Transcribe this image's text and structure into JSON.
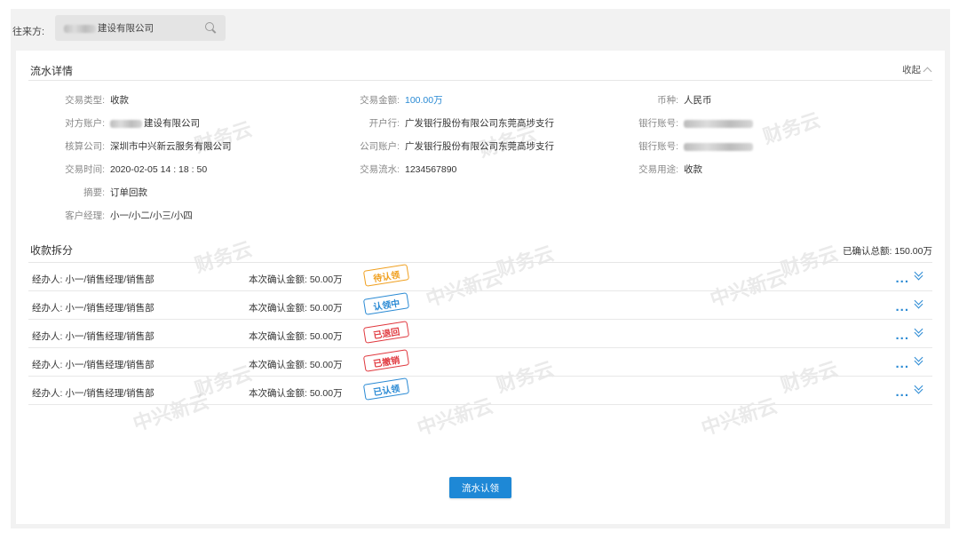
{
  "filter": {
    "label": "往来方:",
    "value_suffix": "建设有限公司"
  },
  "detail": {
    "title": "流水详情",
    "collapse_label": "收起",
    "fields": [
      {
        "label": "交易类型:",
        "value": "收款"
      },
      {
        "label": "交易金额:",
        "value": "100.00万",
        "highlight": true
      },
      {
        "label": "币种:",
        "value": "人民币"
      },
      {
        "label": "对方账户:",
        "value": "建设有限公司",
        "blurred_prefix": true
      },
      {
        "label": "开户行:",
        "value": "广发银行股份有限公司东莞高埗支行"
      },
      {
        "label": "银行账号:",
        "value": "",
        "blurred": true
      },
      {
        "label": "核算公司:",
        "value": "深圳市中兴新云服务有限公司"
      },
      {
        "label": "公司账户:",
        "value": "广发银行股份有限公司东莞高埗支行"
      },
      {
        "label": "银行账号:",
        "value": "",
        "blurred": true
      },
      {
        "label": "交易时间:",
        "value": "2020-02-05  14 : 18 : 50"
      },
      {
        "label": "交易流水:",
        "value": "1234567890"
      },
      {
        "label": "交易用途:",
        "value": "收款"
      },
      {
        "label": "摘要:",
        "value": "订单回款"
      },
      {
        "label": "客户经理:",
        "value": "小一/小二/小三/小四"
      }
    ]
  },
  "split": {
    "title": "收款拆分",
    "total_label": "已确认总额:",
    "total_value": "150.00万",
    "rows": [
      {
        "handler": "经办人: 小一/销售经理/销售部",
        "amount": "本次确认金额: 50.00万",
        "status": "待认领",
        "status_color": "#f0a020"
      },
      {
        "handler": "经办人: 小一/销售经理/销售部",
        "amount": "本次确认金额: 50.00万",
        "status": "认领中",
        "status_color": "#2a8ad4"
      },
      {
        "handler": "经办人: 小一/销售经理/销售部",
        "amount": "本次确认金额: 50.00万",
        "status": "已退回",
        "status_color": "#e0383e"
      },
      {
        "handler": "经办人: 小一/销售经理/销售部",
        "amount": "本次确认金额: 50.00万",
        "status": "已撤销",
        "status_color": "#e0383e"
      },
      {
        "handler": "经办人: 小一/销售经理/销售部",
        "amount": "本次确认金额: 50.00万",
        "status": "已认领",
        "status_color": "#2a8ad4"
      }
    ],
    "more_glyph": "...",
    "expand_icon": "double-chevron-down-icon"
  },
  "action": {
    "claim_button": "流水认领"
  },
  "watermarks": {
    "text_a": "财务云",
    "text_b": "中兴新云"
  },
  "colors": {
    "accent": "#1e88d6",
    "link": "#2a8ad4"
  }
}
